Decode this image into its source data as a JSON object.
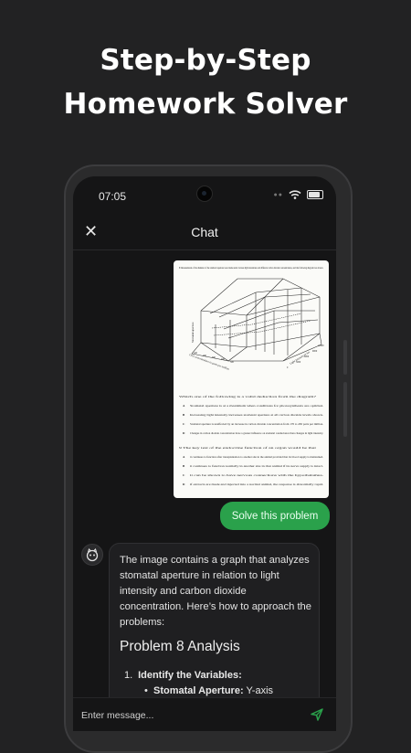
{
  "headline": {
    "line1": "Step-by-Step",
    "line2": "Homework Solver"
  },
  "status_bar": {
    "time": "07:05"
  },
  "app_bar": {
    "title": "Chat",
    "close_icon": "close-icon"
  },
  "uploaded_image": {
    "q8_text": "8  Measurements of the diameter of the stomatal aperture were made under various light intensities and different carbon dioxide concentrations, and the following diagram was drawn.",
    "axis_stomatal": "Stomatal aperture",
    "axis_co2": "CO2 concentration in parts per million",
    "axis_light": "Light intensity in lux",
    "ticks_co2": [
      "100",
      "200",
      "300",
      "400",
      "500"
    ],
    "ticks_light": [
      "0",
      "3000",
      "6000",
      "9000",
      "12000"
    ],
    "question": "Which one of the following is a valid deduction from the diagram?",
    "options": [
      {
        "letter": "A",
        "text": "Stomatal aperture is at a maximum when conditions for photosynthesis are optimal."
      },
      {
        "letter": "B",
        "text": "Increasing light intensity increases stomatal aperture at all carbon dioxide levels shown."
      },
      {
        "letter": "C",
        "text": "Stomatal aperture is unaffected by an increase in carbon dioxide concentration from 170 to 450 parts per million."
      },
      {
        "letter": "D",
        "text": "Changes in carbon dioxide concentration have a greater influence on stomatal conductance than changes in light intensity."
      }
    ],
    "q9_text": "9  The key test of the endocrine function of an organ would be that",
    "q9_options": [
      {
        "letter": "A",
        "text": "it continues to function after transplantation to another site in the animal provided that its blood supply is maintained."
      },
      {
        "letter": "B",
        "text": "it continues to function normally in another site in that animal if its nerve supply is intact."
      },
      {
        "letter": "C",
        "text": "it can be shown to have nervous connections with the hypothalamus."
      },
      {
        "letter": "D",
        "text": "if extracts are made and injected into a normal animal, the response is abnormally rapid."
      }
    ]
  },
  "solve_button": {
    "label": "Solve this problem"
  },
  "assistant": {
    "avatar_icon": "bot-avatar-icon",
    "intro": "The image contains a graph that analyzes stomatal aperture in relation to light intensity and carbon dioxide concentration. Here’s how to approach the problems:",
    "heading": "Problem 8 Analysis",
    "list": [
      {
        "num": "1.",
        "label": "Identify the Variables:"
      }
    ],
    "sub_item": {
      "label": "Stomatal Aperture:",
      "text": " Y-axis"
    }
  },
  "input": {
    "placeholder": "Enter message...",
    "send_icon": "send-icon"
  },
  "colors": {
    "background": "#222223",
    "screen": "#151516",
    "accent": "#2aa14b",
    "bubble": "#1f1f21"
  }
}
